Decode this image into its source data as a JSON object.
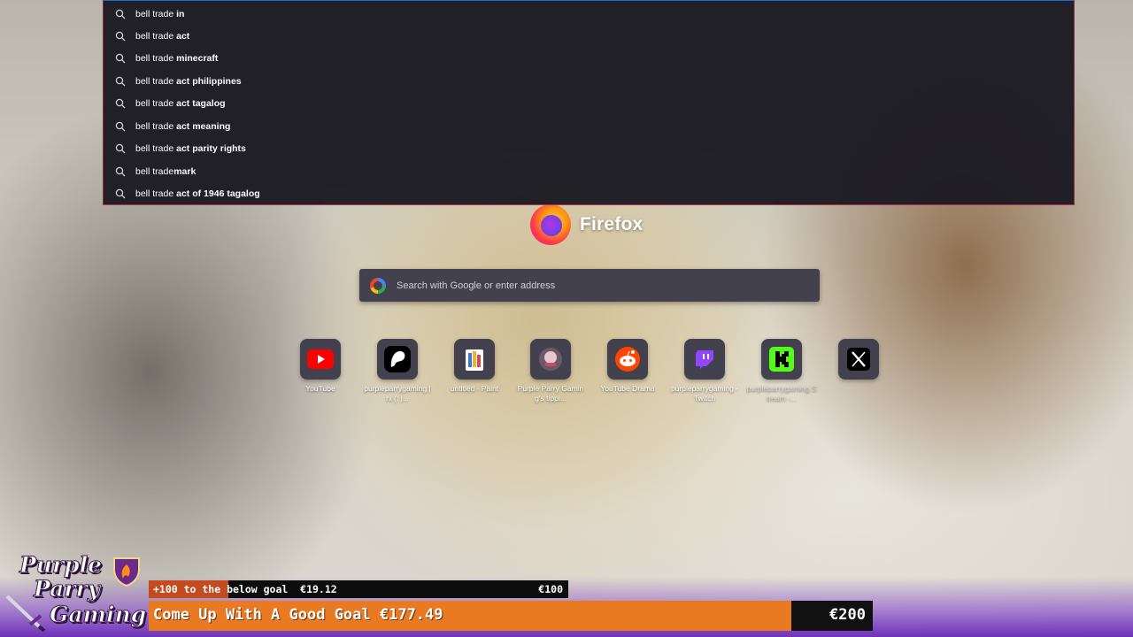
{
  "suggestions": [
    {
      "prefix": "bell trade ",
      "bold": "in"
    },
    {
      "prefix": "bell trade ",
      "bold": "act"
    },
    {
      "prefix": "bell trade ",
      "bold": "minecraft"
    },
    {
      "prefix": "bell trade ",
      "bold": "act philippines"
    },
    {
      "prefix": "bell trade ",
      "bold": "act tagalog"
    },
    {
      "prefix": "bell trade ",
      "bold": "act meaning"
    },
    {
      "prefix": "bell trade ",
      "bold": "act parity rights"
    },
    {
      "prefix": "bell trade",
      "bold": "mark"
    },
    {
      "prefix": "bell trade ",
      "bold": "act of 1946 tagalog"
    }
  ],
  "brand": {
    "name": "Firefox"
  },
  "search": {
    "placeholder": "Search with Google or enter address"
  },
  "top_sites": [
    {
      "label": "YouTube",
      "icon": "youtube-icon",
      "faded": false
    },
    {
      "label": "purpleparrygaming | hi (: |...",
      "icon": "patreon-icon",
      "faded": false
    },
    {
      "label": "untitled - Paint",
      "icon": "paint-icon",
      "faded": false
    },
    {
      "label": "Purple Parry Gaming's tippi...",
      "icon": "avatar-icon",
      "faded": false
    },
    {
      "label": "YouTube Drama",
      "icon": "reddit-icon",
      "faded": false
    },
    {
      "label": "purpleparrygaming - Twitch",
      "icon": "twitch-icon",
      "faded": true
    },
    {
      "label": "purpleparrygaming Stream -...",
      "icon": "kick-icon",
      "faded": true
    },
    {
      "label": "",
      "icon": "x-icon",
      "faded": true
    }
  ],
  "overlay": {
    "logo_lines": [
      "Purple",
      "Parry",
      "Gaming"
    ],
    "goal_small": {
      "text": "+100 to the below goal  €19.12",
      "target": "€100",
      "progress": 0.19
    },
    "goal_big": {
      "text": "Come Up With A Good Goal €177.49",
      "target": "€200",
      "progress": 0.887
    }
  },
  "colors": {
    "panel_bg": "#1c1b22",
    "accent_top": "#1e6ad8",
    "accent_border": "#b33250",
    "goal_small_fill": "#c44a1f",
    "goal_big_fill": "#ea7a22"
  }
}
